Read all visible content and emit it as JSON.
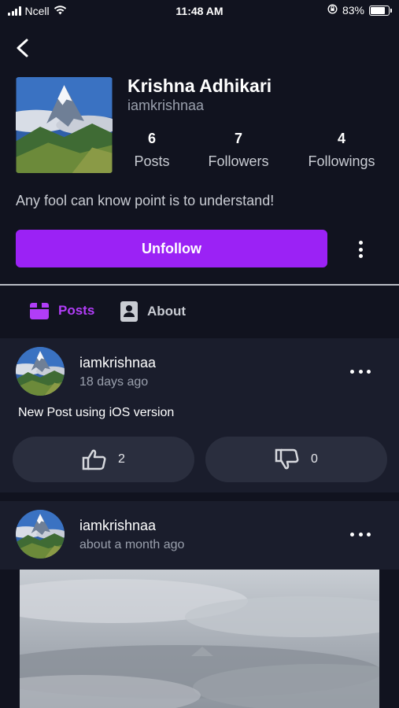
{
  "status_bar": {
    "carrier": "Ncell",
    "time": "11:48 AM",
    "battery": "83%",
    "battery_level": 0.83
  },
  "profile": {
    "name": "Krishna Adhikari",
    "username": "iamkrishnaa",
    "bio": "Any fool can know point is to understand!",
    "stats": [
      {
        "value": "6",
        "label": "Posts"
      },
      {
        "value": "7",
        "label": "Followers"
      },
      {
        "value": "4",
        "label": "Followings"
      }
    ],
    "unfollow_label": "Unfollow"
  },
  "tabs": [
    {
      "label": "Posts",
      "active": true,
      "icon": "posts-box-icon"
    },
    {
      "label": "About",
      "active": false,
      "icon": "contact-card-icon"
    }
  ],
  "posts": [
    {
      "username": "iamkrishnaa",
      "time": "18 days ago",
      "text": "New Post using iOS version",
      "likes": "2",
      "dislikes": "0"
    },
    {
      "username": "iamkrishnaa",
      "time": "about a month ago"
    }
  ],
  "colors": {
    "background": "#11131f",
    "card": "#1a1d2c",
    "accent": "#9b22f5",
    "active_tab": "#b13df7"
  }
}
